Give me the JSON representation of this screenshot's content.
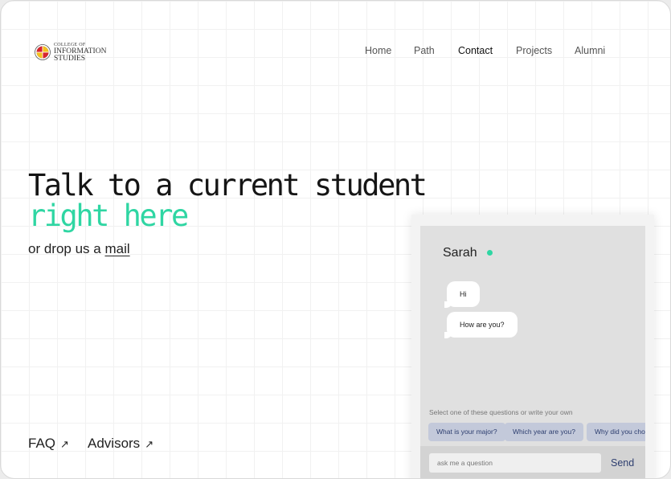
{
  "logo": {
    "line1": "COLLEGE OF",
    "line2": "INFORMATION",
    "line3": "STUDIES",
    "colors": {
      "red": "#d7262e",
      "gold": "#f4c01e",
      "black": "#1a1a1a"
    }
  },
  "nav": {
    "items": [
      {
        "label": "Home",
        "active": false
      },
      {
        "label": "Path",
        "active": false
      },
      {
        "label": "Contact",
        "active": true
      },
      {
        "label": "Projects",
        "active": false
      },
      {
        "label": "Alumni",
        "active": false
      }
    ]
  },
  "hero": {
    "line1": "Talk to a current student",
    "line2": "right here",
    "sub_prefix": "or drop us a ",
    "mail_link": "mail",
    "accent_color": "#2fd6a3"
  },
  "footer_links": [
    {
      "label": "FAQ",
      "icon": "arrow-up-right-icon",
      "glyph": "↗"
    },
    {
      "label": "Advisors",
      "icon": "arrow-up-right-icon",
      "glyph": "↗"
    }
  ],
  "chat": {
    "contact_name": "Sarah",
    "status": "online",
    "messages": [
      {
        "text": "Hi"
      },
      {
        "text": "How are you?"
      }
    ],
    "prompt": "Select one of these questions or write your own",
    "suggestions": [
      {
        "label": "What is your major?"
      },
      {
        "label": "Which year are you?"
      },
      {
        "label": "Why did you cho"
      }
    ],
    "input": {
      "value": "",
      "placeholder": "ask me a question"
    },
    "send_label": "Send",
    "colors": {
      "chip_bg": "#c3c9da",
      "chip_text": "#2d3e6f",
      "panel_bg": "#e0e0e0"
    }
  }
}
